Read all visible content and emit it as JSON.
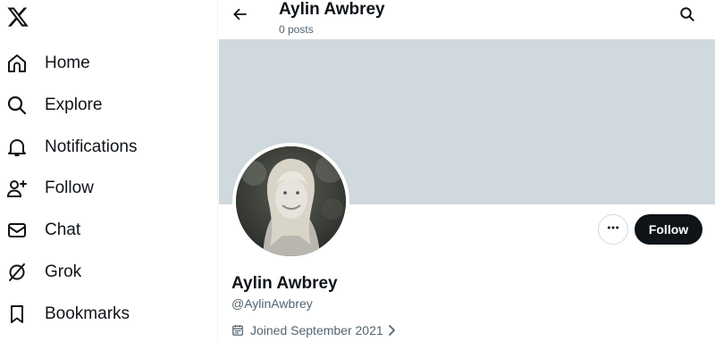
{
  "sidebar": {
    "logo_icon": "x-logo-icon",
    "items": [
      {
        "label": "Home",
        "icon": "home-icon"
      },
      {
        "label": "Explore",
        "icon": "search-icon"
      },
      {
        "label": "Notifications",
        "icon": "bell-icon"
      },
      {
        "label": "Follow",
        "icon": "person-add-icon"
      },
      {
        "label": "Chat",
        "icon": "envelope-icon"
      },
      {
        "label": "Grok",
        "icon": "grok-icon"
      },
      {
        "label": "Bookmarks",
        "icon": "bookmark-icon"
      }
    ]
  },
  "header": {
    "name": "Aylin Awbrey",
    "posts": "0 posts",
    "back_icon": "arrow-left-icon",
    "search_icon": "search-icon"
  },
  "profile": {
    "banner_color": "#cfd9de",
    "name": "Aylin Awbrey",
    "handle": "@AylinAwbrey",
    "joined": "Joined September 2021",
    "more_icon": "ellipsis-icon",
    "follow_label": "Follow"
  },
  "colors": {
    "text": "#0f1419",
    "secondary": "#536471",
    "button": "#0f1419"
  }
}
